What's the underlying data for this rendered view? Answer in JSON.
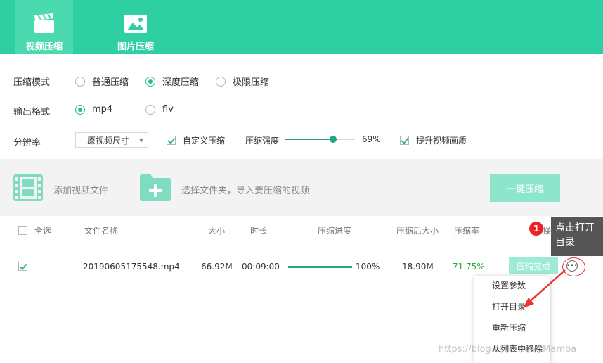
{
  "tabs": [
    {
      "label": "视频压缩",
      "icon": "film-clapper-icon",
      "active": true
    },
    {
      "label": "图片压缩",
      "icon": "picture-icon",
      "active": false
    }
  ],
  "settings": {
    "mode_label": "压缩模式",
    "mode_options": [
      "普通压缩",
      "深度压缩",
      "极限压缩"
    ],
    "mode_selected": "深度压缩",
    "format_label": "输出格式",
    "format_options": [
      "mp4",
      "flv"
    ],
    "format_selected": "mp4",
    "resolution_label": "分辨率",
    "resolution_value": "原视频尺寸",
    "custom_label": "自定义压缩",
    "custom_checked": true,
    "strength_label": "压缩强度",
    "strength_value": "69%",
    "strength_level": 0.69,
    "quality_label": "提升视频画质",
    "quality_checked": true
  },
  "toolbar": {
    "add_video": "添加视频文件",
    "add_folder": "选择文件夹，导入要压缩的视频",
    "compress_all": "一键压缩"
  },
  "table": {
    "select_all": "全选",
    "headers": [
      "文件名称",
      "大小",
      "时长",
      "压缩进度",
      "压缩后大小",
      "压缩率",
      "操作"
    ],
    "row": {
      "checked": true,
      "name": "20190605175548.mp4",
      "size": "66.92M",
      "duration": "00:09:00",
      "progress": "100%",
      "progress_value": 1.0,
      "after_size": "18.90M",
      "ratio": "71.75%",
      "status_button": "压缩完成"
    }
  },
  "menu": {
    "items": [
      "设置参数",
      "打开目录",
      "重新压缩",
      "从列表中移除"
    ]
  },
  "annotation": {
    "badge": "1",
    "tip": "点击打开目录",
    "color": "#e33333"
  },
  "watermark": "https://blog.csdn.net/CMamba",
  "colors": {
    "brand": "#2ecfa0",
    "accent": "#21a585",
    "ratio_green": "#2aaa3a"
  }
}
